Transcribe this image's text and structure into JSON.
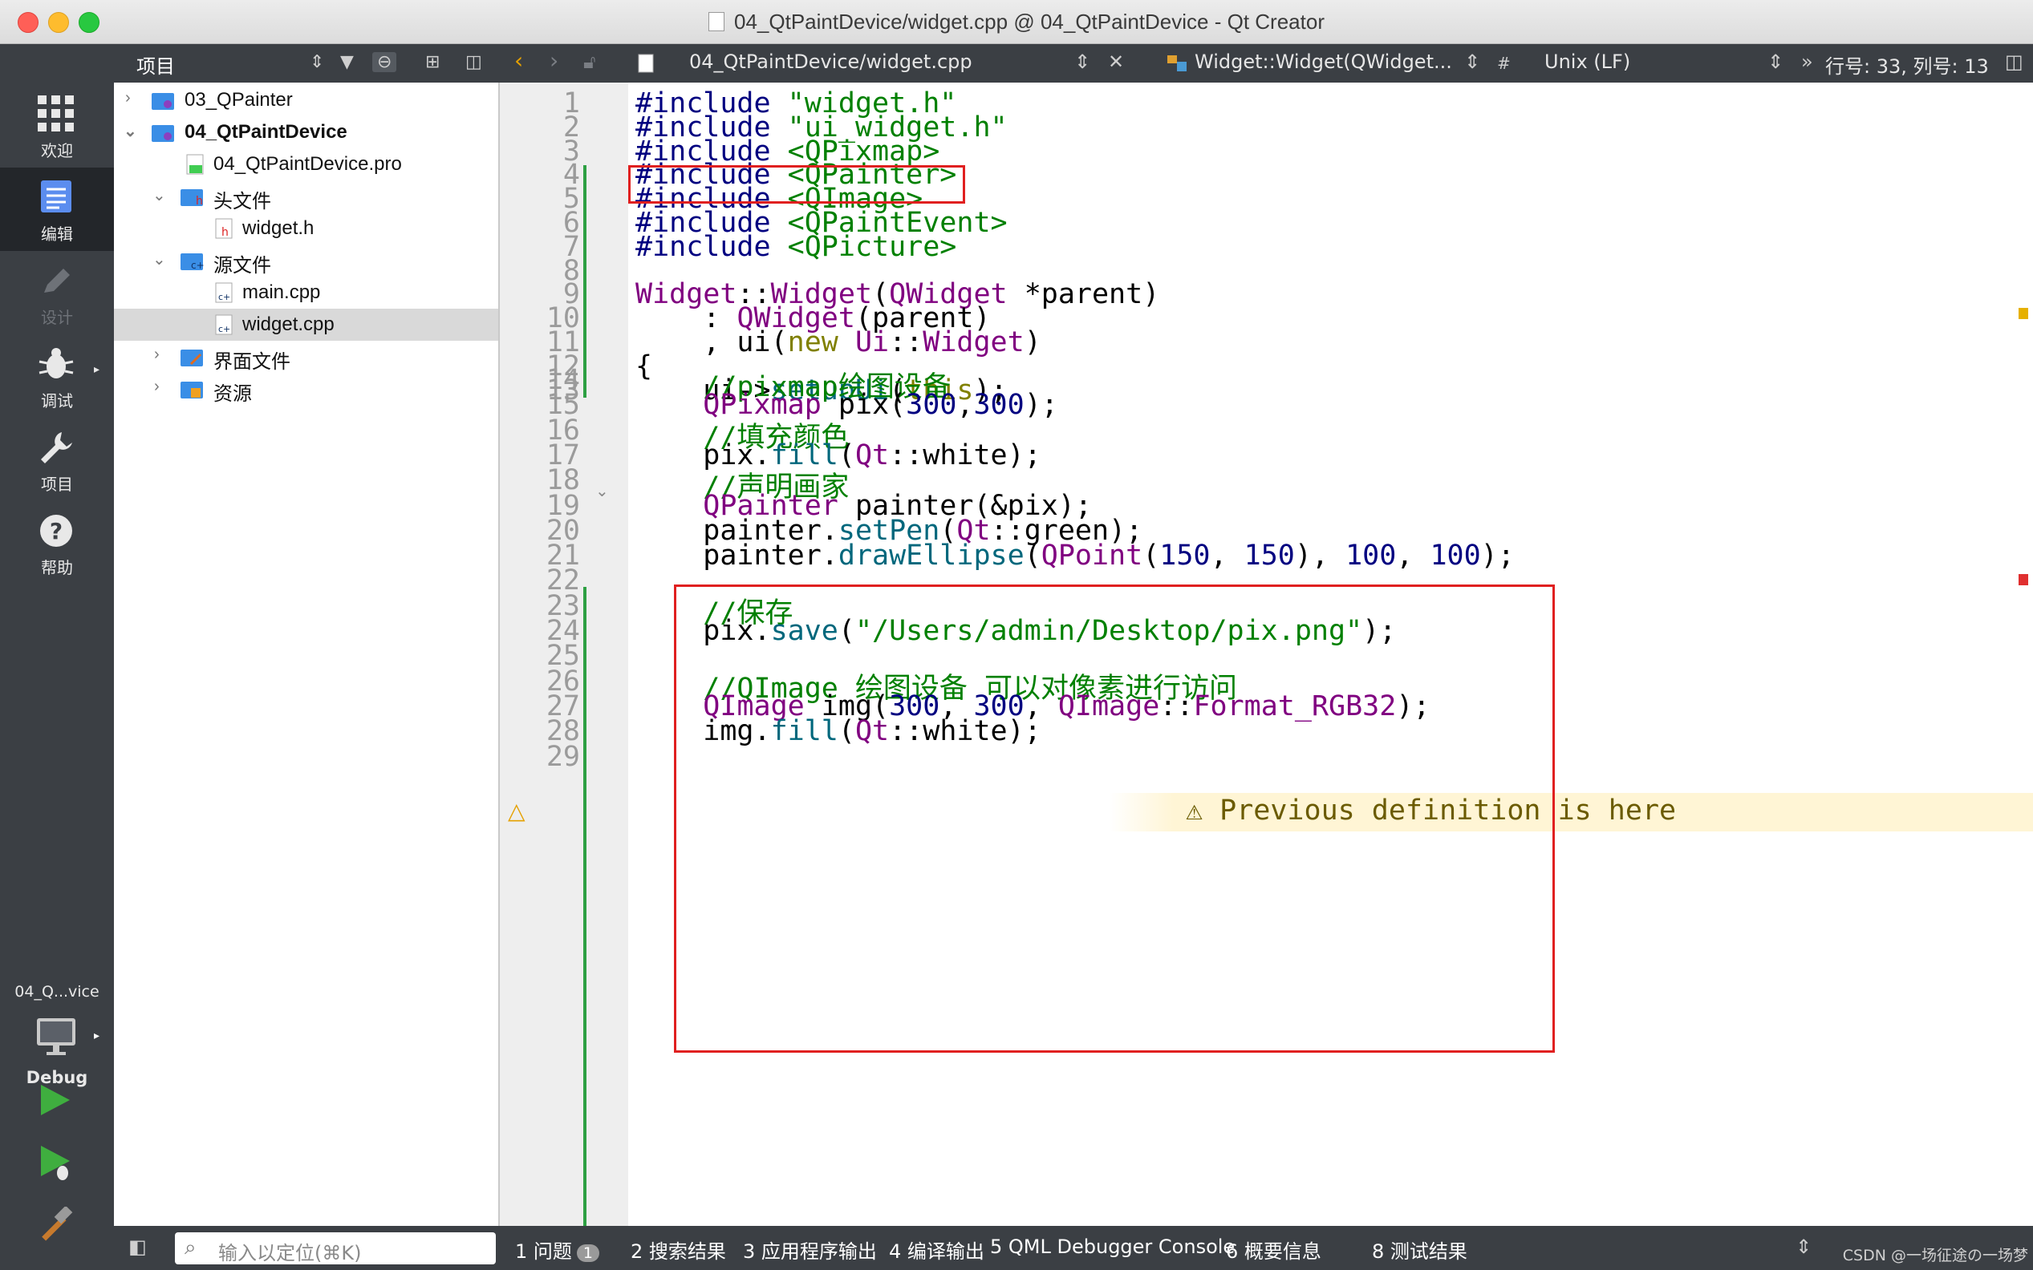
{
  "window": {
    "title": "04_QtPaintDevice/widget.cpp @ 04_QtPaintDevice - Qt Creator"
  },
  "modes": [
    {
      "label": "欢迎",
      "state": "normal"
    },
    {
      "label": "编辑",
      "state": "active"
    },
    {
      "label": "设计",
      "state": "disabled"
    },
    {
      "label": "调试",
      "state": "normal"
    },
    {
      "label": "项目",
      "state": "normal"
    },
    {
      "label": "帮助",
      "state": "normal"
    }
  ],
  "kit": {
    "name": "04_Q...vice",
    "build": "Debug"
  },
  "sidebar": {
    "title": "项目",
    "tree": [
      {
        "label": "03_QPainter",
        "level": 0,
        "bold": false
      },
      {
        "label": "04_QtPaintDevice",
        "level": 0,
        "bold": true
      },
      {
        "label": "04_QtPaintDevice.pro",
        "level": 1,
        "bold": false
      },
      {
        "label": "头文件",
        "level": 1,
        "bold": false
      },
      {
        "label": "widget.h",
        "level": 2,
        "bold": false
      },
      {
        "label": "源文件",
        "level": 1,
        "bold": false
      },
      {
        "label": "main.cpp",
        "level": 2,
        "bold": false
      },
      {
        "label": "widget.cpp",
        "level": 2,
        "bold": false,
        "selected": true
      },
      {
        "label": "界面文件",
        "level": 1,
        "bold": false
      },
      {
        "label": "资源",
        "level": 1,
        "bold": false
      }
    ]
  },
  "editor_toolbar": {
    "file": "04_QtPaintDevice/widget.cpp",
    "symbol": "Widget::Widget(QWidget...",
    "hash": "#",
    "line_ending": "Unix (LF)",
    "position": "行号: 33, 列号: 13"
  },
  "editor": {
    "line_numbers": [
      "1",
      "2",
      "3",
      "4",
      "5",
      "6",
      "7",
      "8",
      "9",
      "10",
      "11",
      "12",
      "13",
      "14",
      "15",
      "16",
      "17",
      "18",
      "19",
      "20",
      "21",
      "22",
      "23",
      "24",
      "25",
      "26",
      "27",
      "28",
      "29"
    ],
    "lines": [
      "#include \"widget.h\"",
      "#include \"ui_widget.h\"",
      "#include <QPixmap>",
      "#include <QPainter>",
      "#include <QImage>",
      "#include <QPaintEvent>",
      "#include <QPicture>",
      "",
      "Widget::Widget(QWidget *parent)",
      "    : QWidget(parent)",
      "    , ui(new Ui::Widget)",
      "{",
      "    ui->setupUi(this);",
      "    //pixmap绘图设备",
      "    QPixmap pix(300,300);",
      "    //填充颜色",
      "    pix.fill(Qt::white);",
      "    //声明画家",
      "    QPainter painter(&pix);",
      "    painter.setPen(Qt::green);",
      "    painter.drawEllipse(QPoint(150, 150), 100, 100);",
      "",
      "    //保存",
      "    pix.save(\"/Users/admin/Desktop/pix.png\");",
      "",
      "    //QImage 绘图设备 可以对像素进行访问",
      "    QImage img(300, 300, QImage::Format_RGB32);",
      "    img.fill(Qt::white);",
      ""
    ],
    "warning_message": "⚠ Previous definition is here"
  },
  "bottom": {
    "locator_placeholder": "输入以定位(⌘K)",
    "tabs": [
      {
        "num": "1",
        "label": "问题",
        "badge": "1"
      },
      {
        "num": "2",
        "label": "搜索结果"
      },
      {
        "num": "3",
        "label": "应用程序输出"
      },
      {
        "num": "4",
        "label": "编译输出"
      },
      {
        "num": "5",
        "label": "QML Debugger Console"
      },
      {
        "num": "6",
        "label": "概要信息"
      },
      {
        "num": "8",
        "label": "测试结果"
      }
    ],
    "watermark": "CSDN @一场征途の一场梦"
  }
}
